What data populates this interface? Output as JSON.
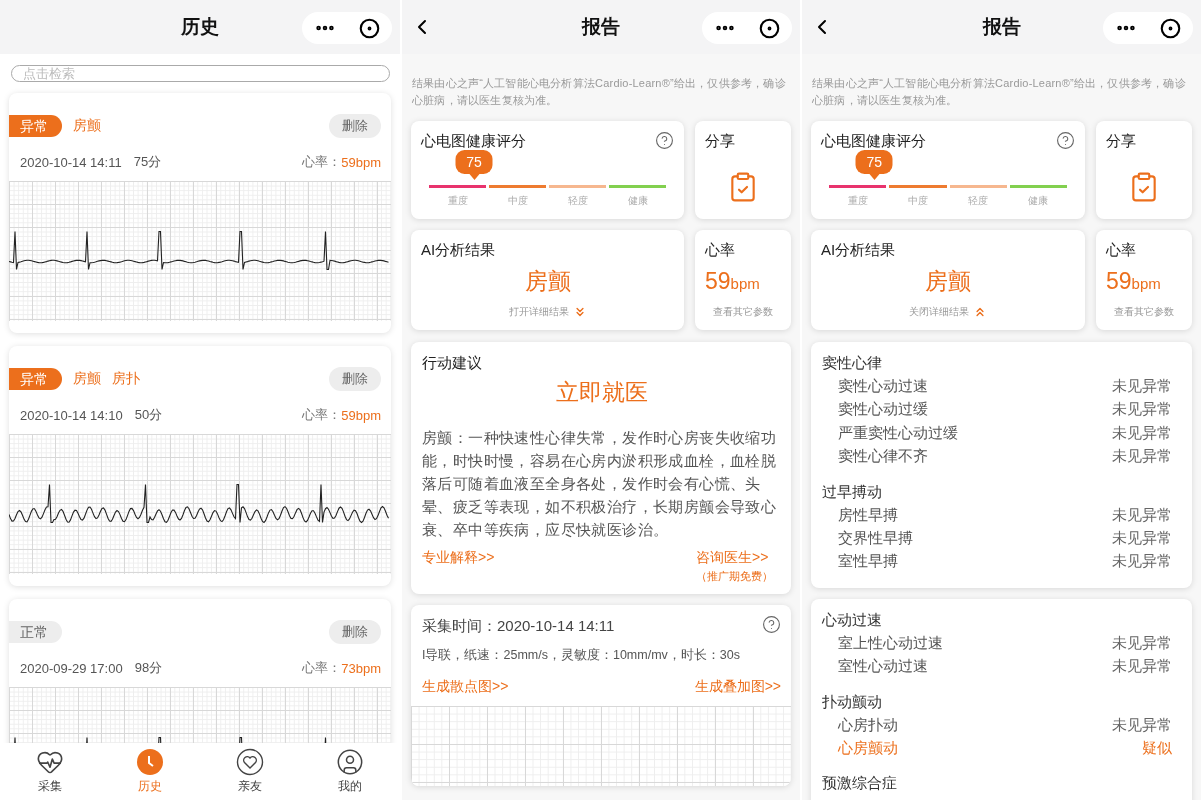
{
  "history": {
    "title": "历史",
    "search": {
      "placeholder": "点击检索"
    },
    "records": [
      {
        "kind": "abnormal",
        "status": "异常",
        "diagnoses": [
          "房颤"
        ],
        "delete": "删除",
        "datetime": "2020-10-14 14:11",
        "score": "75分",
        "hr_label": "心率：",
        "hr": "59bpm"
      },
      {
        "kind": "abnormal",
        "status": "异常",
        "diagnoses": [
          "房颤",
          "房扑"
        ],
        "delete": "删除",
        "datetime": "2020-10-14 14:10",
        "score": "50分",
        "hr_label": "心率：",
        "hr": "59bpm"
      },
      {
        "kind": "normal",
        "status": "正常",
        "delete": "删除",
        "datetime": "2020-09-29 17:00",
        "score": "98分",
        "hr_label": "心率：",
        "hr": "73bpm"
      }
    ],
    "tabbar": [
      {
        "label": "采集",
        "kind": "collect",
        "selected": false
      },
      {
        "label": "历史",
        "kind": "history",
        "selected": true
      },
      {
        "label": "亲友",
        "kind": "friends",
        "selected": false
      },
      {
        "label": "我的",
        "kind": "me",
        "selected": false
      }
    ]
  },
  "reports": [
    {
      "title": "报告",
      "disclaimer": "结果由心之声“人工智能心电分析算法Cardio-Learn®”给出，仅供参考，确诊心脏病，请以医生复核为准。",
      "score": {
        "title": "心电图健康评分",
        "value": "75",
        "level": 0.19,
        "segments": [
          {
            "label": "重度",
            "color": "#e8336d"
          },
          {
            "label": "中度",
            "color": "#ee7b30"
          },
          {
            "label": "轻度",
            "color": "#f6b78f"
          },
          {
            "label": "健康",
            "color": "#82d04f"
          }
        ]
      },
      "share": {
        "title": "分享"
      },
      "ai": {
        "title": "AI分析结果",
        "result": "房颤",
        "toggle": "打开详细结果",
        "expanded": false
      },
      "heart_rate": {
        "title": "心率",
        "value": "59",
        "unit": "bpm",
        "link": "查看其它参数"
      },
      "sections": [
        {
          "kind": "advice",
          "title": "行动建议",
          "action": "立即就医",
          "text": "房颤：一种快速性心律失常，发作时心房丧失收缩功能，时快时慢，容易在心房内淤积形成血栓，血栓脱落后可随着血液至全身各处，发作时会有心慌、头晕、疲乏等表现，如不积极治疗，长期房颤会导致心衰、卒中等疾病，应尽快就医诊治。",
          "links": [
            {
              "label": "专业解释>>"
            },
            {
              "label": "咨询医生>>",
              "note": "（推广期免费）"
            }
          ]
        },
        {
          "kind": "record",
          "title": "采集时间：2020-10-14 14:11",
          "params": "I导联，纸速：25mm/s，灵敏度：10mm/mv，时长：30s",
          "links": [
            {
              "label": "生成散点图>>"
            },
            {
              "label": "生成叠加图>>"
            }
          ]
        }
      ]
    },
    {
      "title": "报告",
      "disclaimer": "结果由心之声“人工智能心电分析算法Cardio-Learn®”给出，仅供参考，确诊心脏病，请以医生复核为准。",
      "score": {
        "title": "心电图健康评分",
        "value": "75",
        "level": 0.19,
        "segments": [
          {
            "label": "重度",
            "color": "#e8336d"
          },
          {
            "label": "中度",
            "color": "#ee7b30"
          },
          {
            "label": "轻度",
            "color": "#f6b78f"
          },
          {
            "label": "健康",
            "color": "#82d04f"
          }
        ]
      },
      "share": {
        "title": "分享"
      },
      "ai": {
        "title": "AI分析结果",
        "result": "房颤",
        "toggle": "关闭详细结果",
        "expanded": true
      },
      "heart_rate": {
        "title": "心率",
        "value": "59",
        "unit": "bpm",
        "link": "查看其它参数"
      },
      "sections": [
        {
          "kind": "findings",
          "groups": [
            {
              "title": "窦性心律",
              "items": [
                {
                  "name": "窦性心动过速",
                  "result": "未见异常",
                  "flagged": false
                },
                {
                  "name": "窦性心动过缓",
                  "result": "未见异常",
                  "flagged": false
                },
                {
                  "name": "严重窦性心动过缓",
                  "result": "未见异常",
                  "flagged": false
                },
                {
                  "name": "窦性心律不齐",
                  "result": "未见异常",
                  "flagged": false
                }
              ]
            },
            {
              "title": "过早搏动",
              "items": [
                {
                  "name": "房性早搏",
                  "result": "未见异常",
                  "flagged": false
                },
                {
                  "name": "交界性早搏",
                  "result": "未见异常",
                  "flagged": false
                },
                {
                  "name": "室性早搏",
                  "result": "未见异常",
                  "flagged": false
                }
              ]
            }
          ]
        },
        {
          "kind": "findings",
          "groups": [
            {
              "title": "心动过速",
              "items": [
                {
                  "name": "室上性心动过速",
                  "result": "未见异常",
                  "flagged": false
                },
                {
                  "name": "室性心动过速",
                  "result": "未见异常",
                  "flagged": false
                }
              ]
            },
            {
              "title": "扑动颤动",
              "items": [
                {
                  "name": "心房扑动",
                  "result": "未见异常",
                  "flagged": false
                },
                {
                  "name": "心房颤动",
                  "result": "疑似",
                  "flagged": true
                }
              ]
            },
            {
              "title": "预激综合症"
            }
          ]
        }
      ]
    }
  ]
}
